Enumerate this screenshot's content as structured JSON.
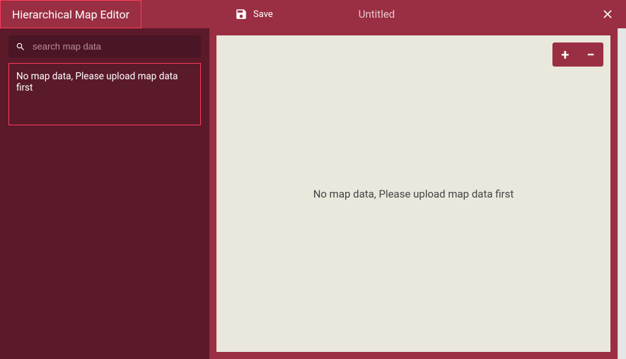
{
  "header": {
    "app_title": "Hierarchical Map Editor",
    "save_label": "Save",
    "doc_title": "Untitled"
  },
  "sidebar": {
    "search_placeholder": "search map data",
    "empty_message": "No map data, Please upload map data first"
  },
  "canvas": {
    "empty_message": "No map data, Please upload map data first"
  },
  "zoom": {
    "in": "+",
    "out": "−"
  },
  "colors": {
    "accent": "#9a2e42",
    "sidebar_bg": "#5a1a2a",
    "highlight_border": "#ff3b5c",
    "canvas_bg": "#eae7dc"
  }
}
